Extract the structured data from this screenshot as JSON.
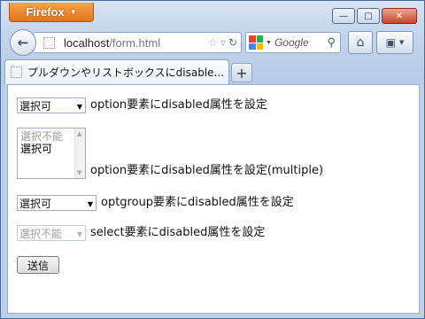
{
  "browser": {
    "menu_button": "Firefox",
    "window_controls": {
      "minimize": "—",
      "maximize": "□",
      "close": "✕"
    },
    "url": {
      "host": "localhost",
      "path": "/form.html"
    },
    "search": {
      "placeholder": "Google"
    },
    "tab": {
      "title": "プルダウンやリストボックスにdisable..."
    },
    "new_tab": "+"
  },
  "form": {
    "row1": {
      "select_value": "選択可",
      "label": "option要素にdisabled属性を設定"
    },
    "row2": {
      "options": [
        "選択不能",
        "選択可"
      ],
      "label": "option要素にdisabled属性を設定(multiple)"
    },
    "row3": {
      "select_value": "選択可",
      "label": "optgroup要素にdisabled属性を設定"
    },
    "row4": {
      "select_value": "選択不能",
      "label": "select要素にdisabled属性を設定"
    },
    "submit_label": "送信"
  }
}
